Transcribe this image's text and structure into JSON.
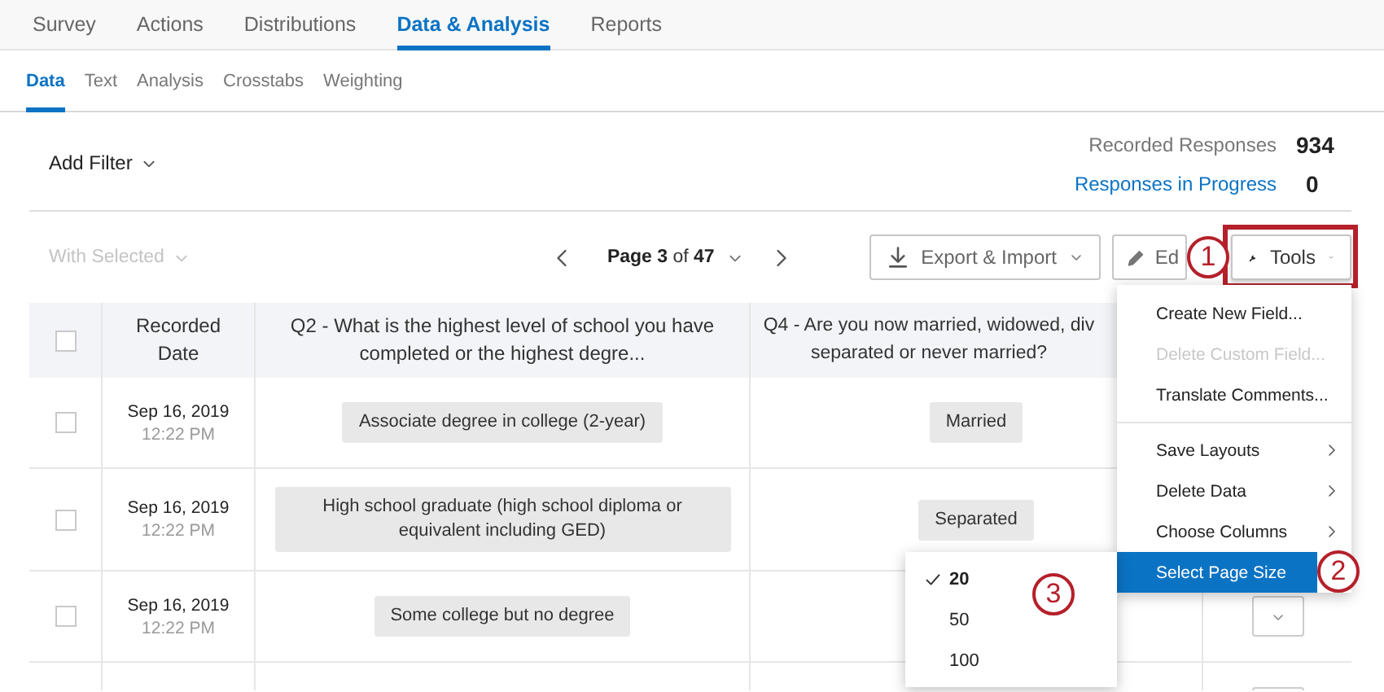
{
  "nav_tabs": [
    {
      "label": "Survey",
      "selected": false
    },
    {
      "label": "Actions",
      "selected": false
    },
    {
      "label": "Distributions",
      "selected": false
    },
    {
      "label": "Data & Analysis",
      "selected": true
    },
    {
      "label": "Reports",
      "selected": false
    }
  ],
  "sub_tabs": [
    {
      "label": "Data",
      "selected": true
    },
    {
      "label": "Text",
      "selected": false
    },
    {
      "label": "Analysis",
      "selected": false
    },
    {
      "label": "Crosstabs",
      "selected": false
    },
    {
      "label": "Weighting",
      "selected": false
    }
  ],
  "filter": {
    "label": "Add Filter"
  },
  "summary": [
    {
      "label": "Recorded Responses",
      "value": "934",
      "kind": "text"
    },
    {
      "label": "Responses in Progress",
      "value": "0",
      "kind": "link"
    }
  ],
  "toolbar": {
    "with_selected": {
      "label": "With Selected",
      "disabled": true
    },
    "page": "**Page 3** of **47**",
    "buttons": [
      {
        "kind": "export",
        "label": "Export & Import"
      },
      {
        "kind": "edit",
        "label": "Ed"
      },
      {
        "kind": "tools",
        "label": "Tools",
        "highlighted": true,
        "callout": "1"
      }
    ]
  },
  "tools_menu": {
    "groups": [
      [
        {
          "label": "Create New Field...",
          "disabled": false,
          "submenu": false,
          "selected": false
        },
        {
          "label": "Delete Custom Field...",
          "disabled": true,
          "submenu": false,
          "selected": false
        },
        {
          "label": "Translate Comments...",
          "disabled": false,
          "submenu": false,
          "selected": false
        }
      ],
      [
        {
          "label": "Save Layouts",
          "disabled": false,
          "submenu": true,
          "selected": false
        },
        {
          "label": "Delete Data",
          "disabled": false,
          "submenu": true,
          "selected": false
        },
        {
          "label": "Choose Columns",
          "disabled": false,
          "submenu": true,
          "selected": false
        },
        {
          "label": "Select Page Size",
          "disabled": false,
          "submenu": false,
          "selected": true,
          "callout": "2"
        }
      ]
    ]
  },
  "page_size_menu": {
    "callout": "3",
    "options": [
      {
        "label": "20",
        "selected": true
      },
      {
        "label": "50",
        "selected": false
      },
      {
        "label": "100",
        "selected": false
      }
    ]
  },
  "table": {
    "select_all": {
      "checked": false
    },
    "columns": [
      {
        "label": "Recorded Date"
      },
      {
        "label": "Q2 - What is the highest level of school you have completed or the highest degre..."
      },
      {
        "lines": [
          "Q4 - Are you now married, widowed, div",
          "separated or never married?"
        ]
      }
    ],
    "rows": [
      {
        "checked": false,
        "date": "Sep 16, 2019",
        "time": "12:22 PM",
        "answers": [
          "Associate degree in college (2-year)",
          "Married"
        ]
      },
      {
        "checked": false,
        "date": "Sep 16, 2019",
        "time": "12:22 PM",
        "answers": [
          "High school graduate (high school diploma or equivalent including GED)",
          "Separated"
        ]
      },
      {
        "checked": false,
        "date": "Sep 16, 2019",
        "time": "12:22 PM",
        "answers": [
          "Some college but no degree"
        ],
        "action_button": true
      },
      {
        "action_button": true
      }
    ]
  }
}
